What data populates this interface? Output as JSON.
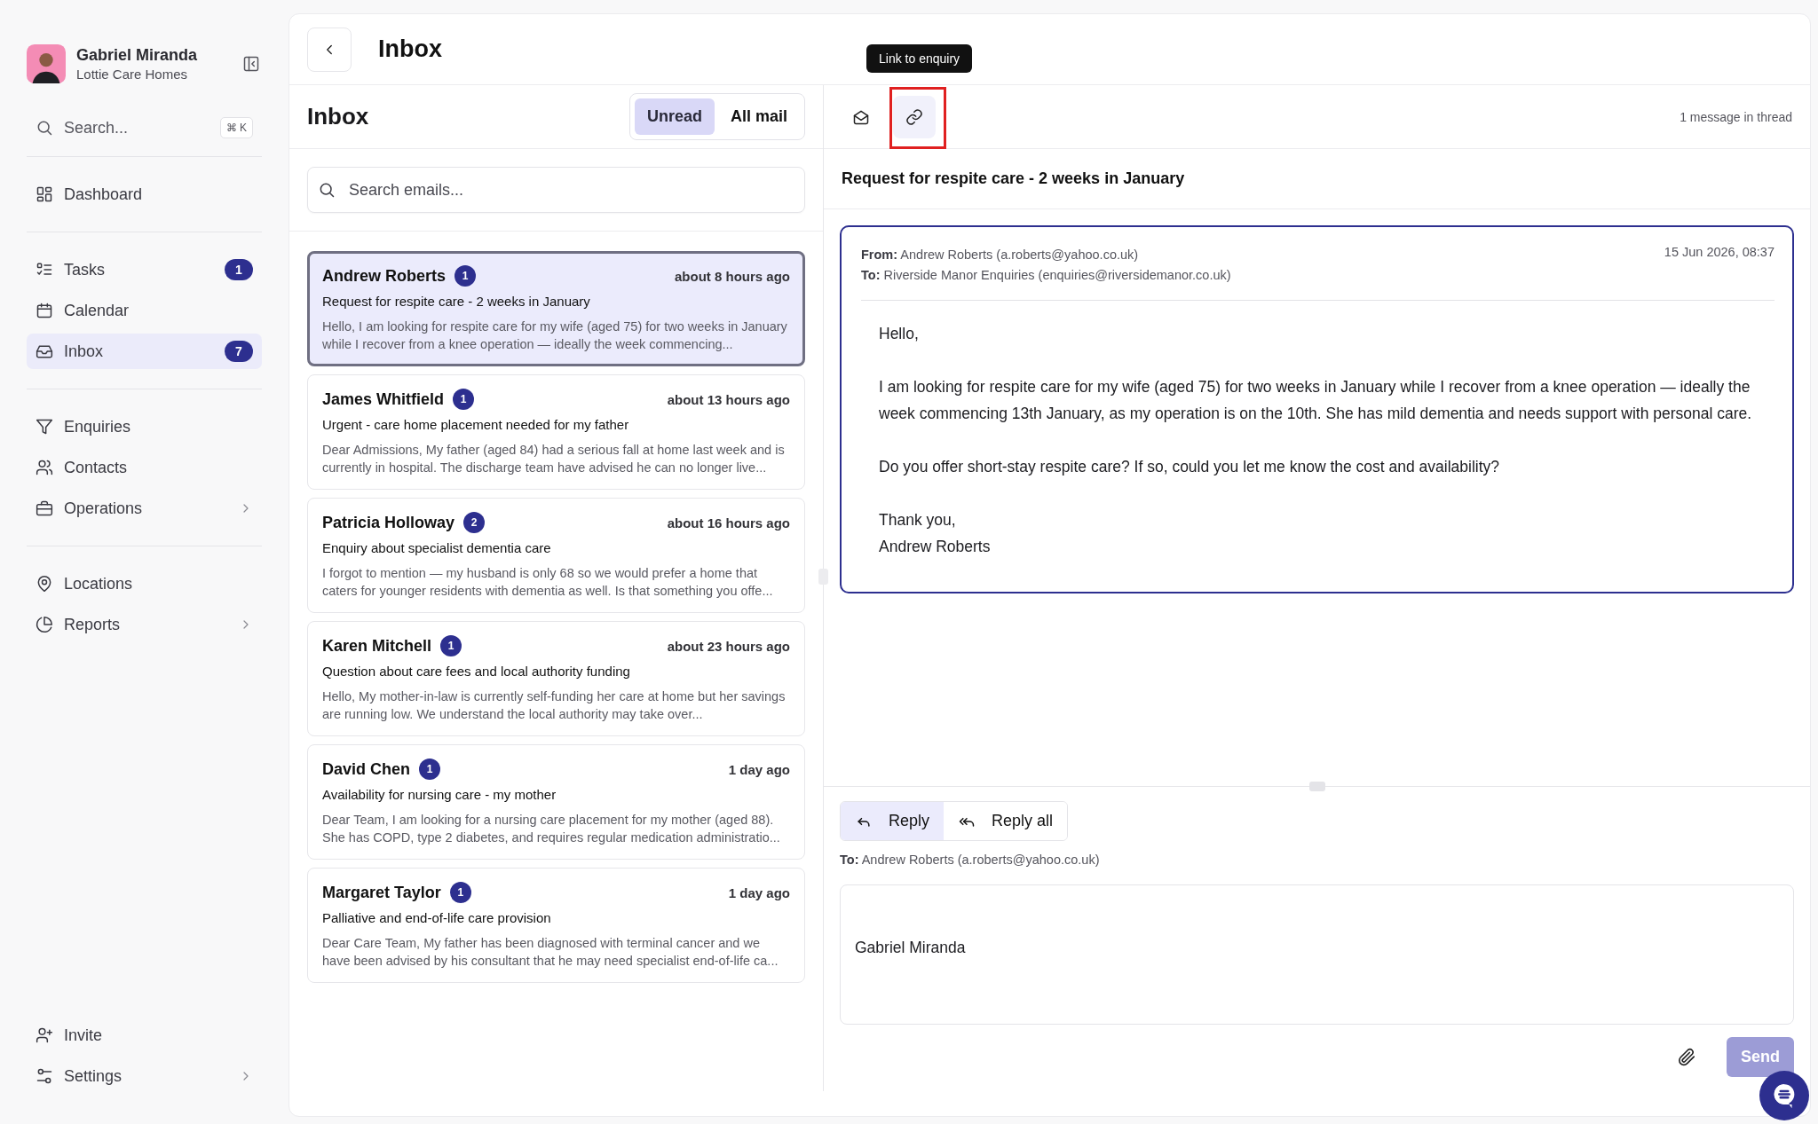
{
  "sidebar": {
    "user": {
      "name": "Gabriel Miranda",
      "organization": "Lottie Care Homes"
    },
    "search": {
      "placeholder": "Search...",
      "shortcut": "⌘ K"
    },
    "groups": [
      {
        "items": [
          {
            "label": "Dashboard",
            "selected": false
          }
        ]
      },
      {
        "items": [
          {
            "label": "Tasks",
            "badge": "1",
            "selected": false
          },
          {
            "label": "Calendar",
            "selected": false
          },
          {
            "label": "Inbox",
            "badge": "7",
            "selected": true
          }
        ]
      },
      {
        "items": [
          {
            "label": "Enquiries",
            "selected": false
          },
          {
            "label": "Contacts",
            "selected": false
          },
          {
            "label": "Operations",
            "has_submenu": true,
            "selected": false
          }
        ]
      },
      {
        "items": [
          {
            "label": "Locations",
            "selected": false
          },
          {
            "label": "Reports",
            "has_submenu": true,
            "selected": false
          }
        ]
      }
    ],
    "footer": [
      {
        "label": "Invite",
        "selected": false
      },
      {
        "label": "Settings",
        "has_submenu": true,
        "selected": false
      }
    ]
  },
  "header": {
    "title": "Inbox"
  },
  "inbox": {
    "title": "Inbox",
    "filters": [
      {
        "label": "Unread",
        "selected": true
      },
      {
        "label": "All mail",
        "selected": false
      }
    ],
    "search": {
      "placeholder": "Search emails..."
    },
    "messages": [
      {
        "sender": "Andrew Roberts",
        "count": "1",
        "time": "about 8 hours ago",
        "subject": "Request for respite care - 2 weeks in January",
        "preview": "Hello, I am looking for respite care for my wife (aged 75) for two weeks in January while I recover from a knee operation — ideally the week commencing...",
        "selected": true
      },
      {
        "sender": "James Whitfield",
        "count": "1",
        "time": "about 13 hours ago",
        "subject": "Urgent - care home placement needed for my father",
        "preview": "Dear Admissions, My father (aged 84) had a serious fall at home last week and is currently in hospital. The discharge team have advised he can no longer live...",
        "selected": false
      },
      {
        "sender": "Patricia Holloway",
        "count": "2",
        "time": "about 16 hours ago",
        "subject": "Enquiry about specialist dementia care",
        "preview": "I forgot to mention — my husband is only 68 so we would prefer a home that caters for younger residents with dementia as well. Is that something you offe...",
        "selected": false
      },
      {
        "sender": "Karen Mitchell",
        "count": "1",
        "time": "about 23 hours ago",
        "subject": "Question about care fees and local authority funding",
        "preview": "Hello, My mother-in-law is currently self-funding her care at home but her savings are running low. We understand the local authority may take over...",
        "selected": false
      },
      {
        "sender": "David Chen",
        "count": "1",
        "time": "1 day ago",
        "subject": "Availability for nursing care - my mother",
        "preview": "Dear Team, I am looking for a nursing care placement for my mother (aged 88). She has COPD, type 2 diabetes, and requires regular medication administratio...",
        "selected": false
      },
      {
        "sender": "Margaret Taylor",
        "count": "1",
        "time": "1 day ago",
        "subject": "Palliative and end-of-life care provision",
        "preview": "Dear Care Team, My father has been diagnosed with terminal cancer and we have been advised by his consultant that he may need specialist end-of-life ca...",
        "selected": false
      }
    ]
  },
  "thread": {
    "toolbar": [
      {
        "kind": "envelope",
        "highlighted": false
      },
      {
        "kind": "link",
        "highlighted": true,
        "tooltip": "Link to enquiry"
      }
    ],
    "count": "1 message in thread",
    "subject": "Request for respite care - 2 weeks in January",
    "message": {
      "from_label": "From:",
      "from": "Andrew Roberts (a.roberts@yahoo.co.uk)",
      "to_label": "To:",
      "to": "Riverside Manor Enquiries (enquiries@riversidemanor.co.uk)",
      "date": "15 Jun 2026, 08:37",
      "paragraphs": [
        [
          "Hello,"
        ],
        [
          "I am looking for respite care for my wife (aged 75) for two weeks in January while I recover from a knee operation — ideally the week commencing 13th January, as my operation is on the 10th. She has mild dementia and needs support with personal care."
        ],
        [
          "Do you offer short-stay respite care? If so, could you let me know the cost and availability?"
        ],
        [
          "Thank you,",
          "Andrew Roberts"
        ]
      ]
    },
    "reply": {
      "modes": [
        {
          "kind": "reply",
          "label": "Reply",
          "selected": true
        },
        {
          "kind": "reply-all",
          "label": "Reply all",
          "selected": false
        }
      ],
      "to_label": "To:",
      "to": "Andrew Roberts (a.roberts@yahoo.co.uk)",
      "body": "Gabriel Miranda",
      "send": {
        "label": "Send",
        "disabled": true
      }
    }
  }
}
